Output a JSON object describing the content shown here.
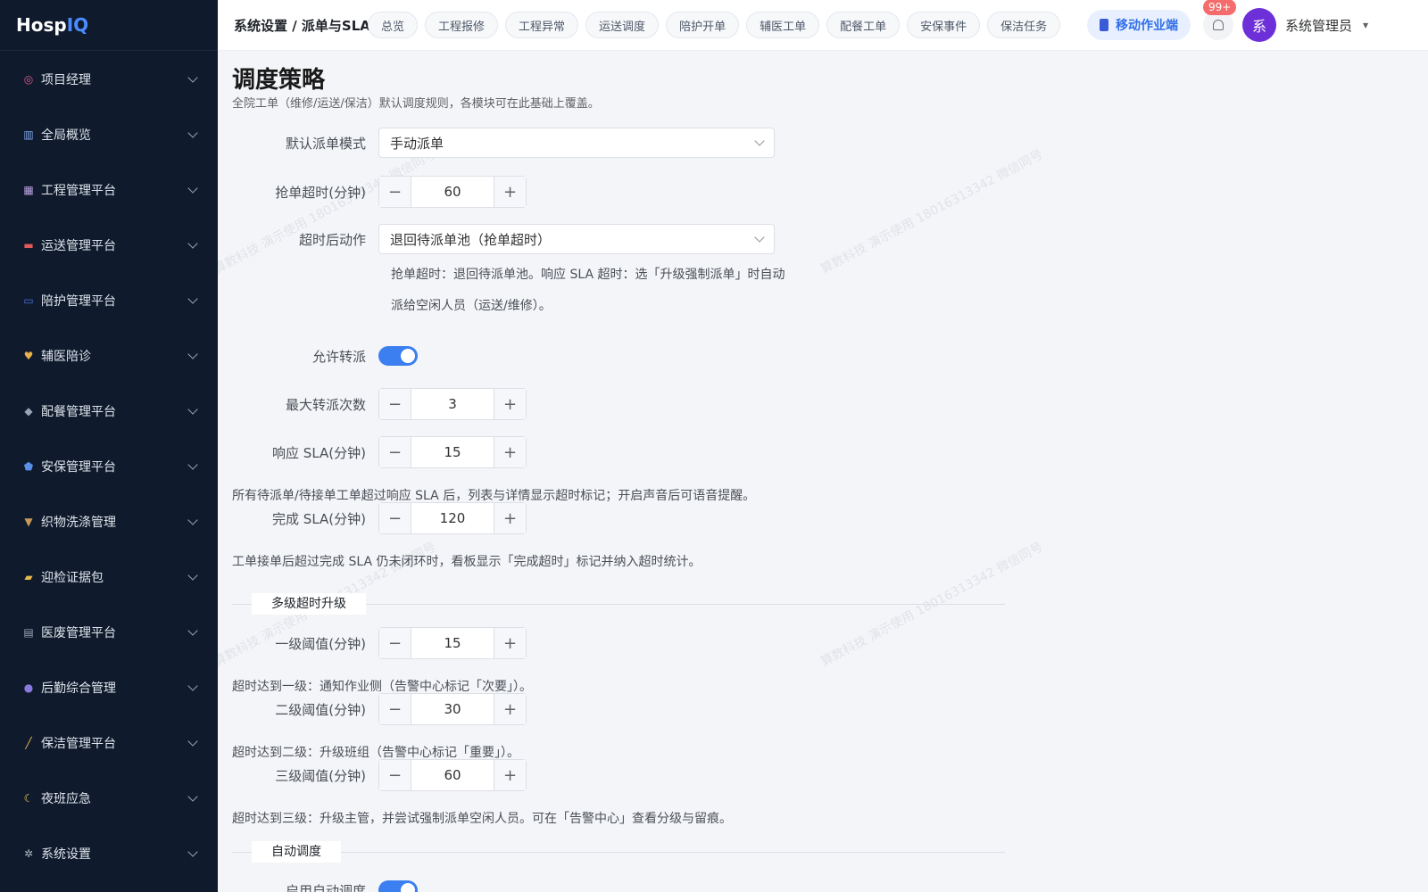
{
  "app": {
    "logo_main": "Hosp",
    "logo_accent": "IQ"
  },
  "sidebar": {
    "items": [
      {
        "label": "项目经理",
        "icon": "target-icon"
      },
      {
        "label": "全局概览",
        "icon": "chart-icon"
      },
      {
        "label": "工程管理平台",
        "icon": "building-icon"
      },
      {
        "label": "运送管理平台",
        "icon": "truck-icon"
      },
      {
        "label": "陪护管理平台",
        "icon": "bed-icon"
      },
      {
        "label": "辅医陪诊",
        "icon": "heart-icon"
      },
      {
        "label": "配餐管理平台",
        "icon": "meal-icon"
      },
      {
        "label": "安保管理平台",
        "icon": "shield-icon"
      },
      {
        "label": "织物洗涤管理",
        "icon": "basket-icon"
      },
      {
        "label": "迎检证据包",
        "icon": "folder-icon"
      },
      {
        "label": "医废管理平台",
        "icon": "bin-icon"
      },
      {
        "label": "后勤综合管理",
        "icon": "people-icon"
      },
      {
        "label": "保洁管理平台",
        "icon": "broom-icon"
      },
      {
        "label": "夜班应急",
        "icon": "moon-icon"
      },
      {
        "label": "系统设置",
        "icon": "gear-icon"
      }
    ]
  },
  "header": {
    "breadcrumb": "系统设置 / 派单与SLA",
    "tabs": [
      "总览",
      "工程报修",
      "工程异常",
      "运送调度",
      "陪护开单",
      "辅医工单",
      "配餐工单",
      "安保事件",
      "保洁任务"
    ],
    "mobile_button": "移动作业端",
    "notification_badge": "99+",
    "avatar_letter": "系",
    "username": "系统管理员"
  },
  "main": {
    "title": "调度策略",
    "description": "全院工单（维修/运送/保洁）默认调度规则，各模块可在此基础上覆盖。",
    "watermark": "算数科技 演示使用 18016313342 微信同号",
    "default_mode": {
      "label": "默认派单模式",
      "value": "手动派单"
    },
    "grab_timeout": {
      "label": "抢单超时(分钟)",
      "value": "60"
    },
    "timeout_action": {
      "label": "超时后动作",
      "value": "退回待派单池（抢单超时）"
    },
    "timeout_note": "抢单超时：退回待派单池。响应 SLA 超时：选「升级强制派单」时自动派给空闲人员（运送/维修）。",
    "allow_transfer": {
      "label": "允许转派",
      "enabled": true
    },
    "max_transfer": {
      "label": "最大转派次数",
      "value": "3"
    },
    "response_sla": {
      "label": "响应 SLA(分钟)",
      "value": "15"
    },
    "response_sla_note": "所有待派单/待接单工单超过响应 SLA 后，列表与详情显示超时标记；开启声音后可语音提醒。",
    "complete_sla": {
      "label": "完成 SLA(分钟)",
      "value": "120"
    },
    "complete_sla_note": "工单接单后超过完成 SLA 仍未闭环时，看板显示「完成超时」标记并纳入超时统计。",
    "escalation_section": "多级超时升级",
    "level1": {
      "label": "一级阈值(分钟)",
      "value": "15",
      "note": "超时达到一级：通知作业侧（告警中心标记「次要」）。"
    },
    "level2": {
      "label": "二级阈值(分钟)",
      "value": "30",
      "note": "超时达到二级：升级班组（告警中心标记「重要」）。"
    },
    "level3": {
      "label": "三级阈值(分钟)",
      "value": "60",
      "note": "超时达到三级：升级主管，并尝试强制派单空闲人员。可在「告警中心」查看分级与留痕。"
    },
    "auto_section": "自动调度",
    "auto_enable": {
      "label": "启用自动调度",
      "enabled": true
    }
  }
}
